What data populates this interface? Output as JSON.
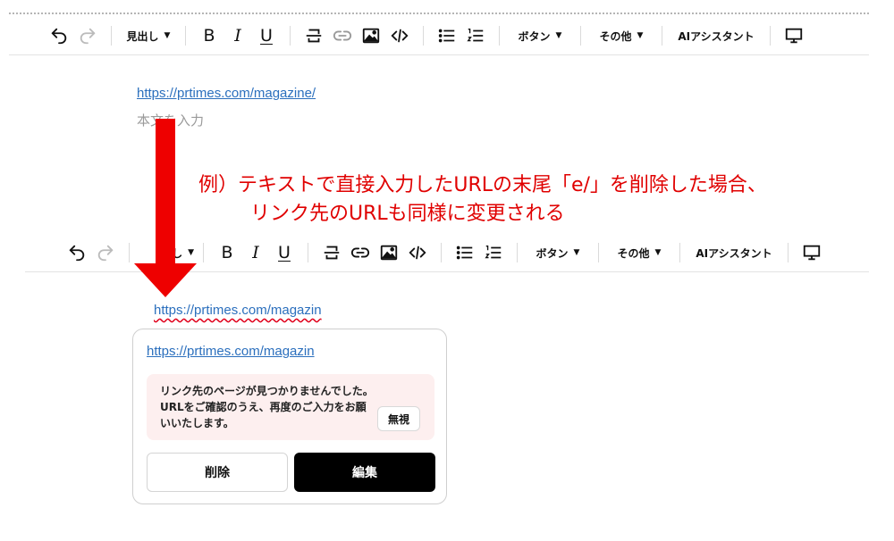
{
  "toolbar_top": {
    "heading_label": "見出し",
    "button_label": "ボタン",
    "other_label": "その他",
    "ai_label": "AIアシスタント",
    "bold": "B",
    "italic": "I",
    "underline": "U"
  },
  "toolbar_bottom": {
    "heading_label": "し",
    "button_label": "ボタン",
    "other_label": "その他",
    "ai_label": "AIアシスタント",
    "bold": "B",
    "italic": "I",
    "underline": "U"
  },
  "icons": [
    "undo-icon",
    "redo-icon",
    "strikethrough-icon",
    "link-icon",
    "image-icon",
    "code-icon",
    "bullet-list-icon",
    "numbered-list-icon",
    "monitor-icon"
  ],
  "editor_before": {
    "link_text": "https://prtimes.com/magazine/",
    "placeholder": "本文を入力"
  },
  "annotation": {
    "line1": "例）テキストで直接入力したURLの末尾「e/」を削除した場合、",
    "line2": "リンク先のURLも同様に変更される"
  },
  "editor_after": {
    "link_text": "https://prtimes.com/magazin"
  },
  "link_popup": {
    "url": "https://prtimes.com/magazin",
    "notice": "リンク先のページが見つかりませんでした。URLをご確認のうえ、再度のご入力をお願いいたします。",
    "ignore_label": "無視",
    "delete_label": "削除",
    "edit_label": "編集"
  },
  "colors": {
    "link": "#2b6fbd",
    "annotation": "#e00000",
    "arrow": "#ee0000",
    "notice_bg": "#fdefef",
    "primary_button": "#000000"
  }
}
